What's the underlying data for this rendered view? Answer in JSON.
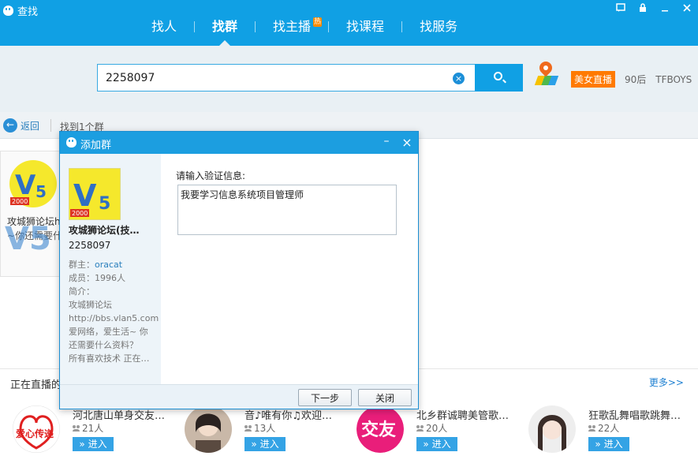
{
  "window": {
    "title": "查找",
    "controls": [
      "feedback-icon",
      "lock-icon",
      "minimize-icon",
      "close-icon"
    ]
  },
  "nav": {
    "tabs": [
      {
        "label": "找人",
        "active": false
      },
      {
        "label": "找群",
        "active": true
      },
      {
        "label": "找主播",
        "active": false,
        "badge": "热"
      },
      {
        "label": "找课程",
        "active": false
      },
      {
        "label": "找服务",
        "active": false
      }
    ]
  },
  "search": {
    "value": "2258097",
    "hot_tag": "美女直播",
    "quick_tags": [
      "90后",
      "TFBOYS"
    ]
  },
  "results": {
    "back_label": "返回",
    "count_text": "找到1个群",
    "card": {
      "name": "攻城狮论坛h",
      "sub": "~你还需要什",
      "badge": "2000"
    }
  },
  "live": {
    "title": "正在直播的",
    "more": "更多>>",
    "items": [
      {
        "name": "河北唐山单身交友…",
        "count": "21人",
        "enter": "» 进入",
        "avatar": "爱心传递"
      },
      {
        "name": "音♪唯有你♫欢迎…",
        "count": "13人",
        "enter": "» 进入",
        "avatar": ""
      },
      {
        "name": "北乡群诚聘美管歌…",
        "count": "20人",
        "enter": "» 进入",
        "avatar": "交友"
      },
      {
        "name": "狂歌乱舞唱歌跳舞…",
        "count": "22人",
        "enter": "» 进入",
        "avatar": ""
      }
    ]
  },
  "dialog": {
    "title": "添加群",
    "group": {
      "name": "攻城狮论坛(技…",
      "id": "2258097",
      "owner_label": "群主：",
      "owner": "oracat",
      "members": "成员：1996人",
      "intro_label": "简介：",
      "intro_lines": [
        "攻城狮论坛",
        "http://bbs.vlan5.com",
        "爱网络，爱生活~ 你",
        "还需要什么资料？",
        "所有喜欢技术 正在…"
      ],
      "logo_badge": "2000"
    },
    "prompt": "请输入验证信息:",
    "message": "我要学习信息系统项目管理师",
    "next_button": "下一步",
    "close_button": "关闭"
  },
  "watermark": {
    "title": "攻城狮论坛",
    "url": "bbs.Vlan5.com"
  },
  "colors": {
    "primary": "#10a0e4",
    "accent_orange": "#ff7a00",
    "link": "#1c7fd1"
  }
}
